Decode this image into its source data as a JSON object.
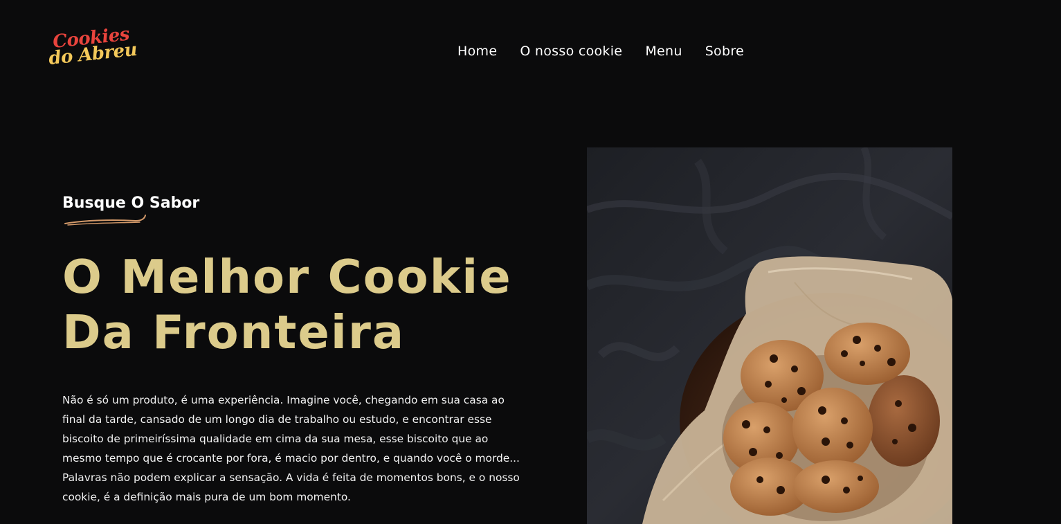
{
  "header": {
    "logo": {
      "line1": "Cookies",
      "line2": "do Abreu",
      "line1_color": "#e8443d",
      "line2_color": "#f3c85a"
    },
    "nav": [
      {
        "label": "Home"
      },
      {
        "label": "O nosso cookie"
      },
      {
        "label": "Menu"
      },
      {
        "label": "Sobre"
      }
    ]
  },
  "hero": {
    "kicker": "Busque O Sabor",
    "swash_color": "#d49a6a",
    "title_line1": "O Melhor Cookie",
    "title_line2": "Da Fronteira",
    "title_color": "#dccb8b",
    "description": "Não é só um produto, é uma experiência. Imagine você, chegando em sua casa ao final da tarde, cansado de um longo dia de trabalho ou estudo, e encontrar esse biscoito de primeiríssima qualidade em cima da sua mesa, esse biscoito que ao mesmo tempo que é crocante por fora, é macio por dentro, e quando você o morde... Palavras não podem explicar a sensação. A vida é feita de momentos bons, e o nosso cookie, é a definição mais pura de um bom momento.",
    "image": "chocolate-chip-cookies-photo"
  }
}
